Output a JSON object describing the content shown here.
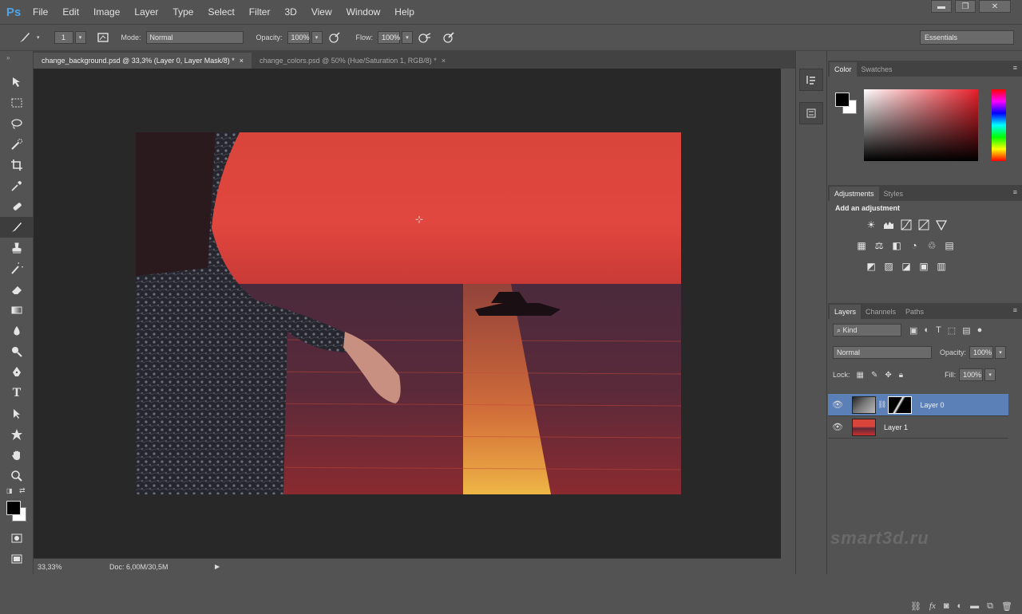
{
  "app": {
    "logo": "Ps"
  },
  "menu": [
    "File",
    "Edit",
    "Image",
    "Layer",
    "Type",
    "Select",
    "Filter",
    "3D",
    "View",
    "Window",
    "Help"
  ],
  "window_controls": {
    "minimize": "▬",
    "restore": "❐",
    "close": "✕"
  },
  "options": {
    "brush_size": "1",
    "mode_label": "Mode:",
    "mode_value": "Normal",
    "opacity_label": "Opacity:",
    "opacity_value": "100%",
    "flow_label": "Flow:",
    "flow_value": "100%",
    "workspace": "Essentials"
  },
  "tabs": [
    {
      "label": "change_background.psd @ 33,3% (Layer 0, Layer Mask/8) *",
      "close": "×"
    },
    {
      "label": "change_colors.psd @ 50% (Hue/Saturation 1, RGB/8) *",
      "close": "×"
    }
  ],
  "status": {
    "zoom": "33,33%",
    "doc": "Doc: 6,00M/30,5M"
  },
  "color_panel": {
    "tabs": [
      "Color",
      "Swatches"
    ],
    "fg_color": "#000000",
    "bg_color": "#ffffff"
  },
  "adjustments_panel": {
    "tabs": [
      "Adjustments",
      "Styles"
    ],
    "title": "Add an adjustment"
  },
  "layers_panel": {
    "tabs": [
      "Layers",
      "Channels",
      "Paths"
    ],
    "kind_label": "Kind",
    "blend_mode": "Normal",
    "opacity_label": "Opacity:",
    "opacity_value": "100%",
    "lock_label": "Lock:",
    "fill_label": "Fill:",
    "fill_value": "100%",
    "layers": [
      {
        "name": "Layer 0",
        "selected": true
      },
      {
        "name": "Layer 1",
        "selected": false
      }
    ]
  },
  "watermark": "smart3d.ru",
  "colors": {
    "accent_selected": "#5b80b8",
    "panel_bg": "#535353",
    "canvas_bg": "#282828"
  }
}
